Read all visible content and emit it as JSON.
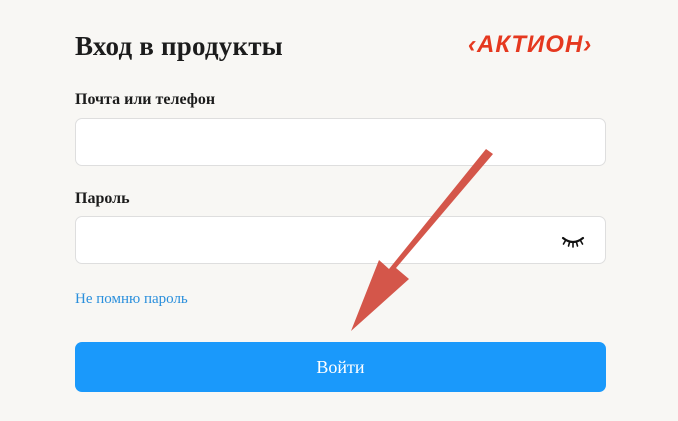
{
  "header": {
    "title": "Вход в продукты",
    "logo_text": "‹АКТИОН›",
    "logo_color": "#e5381f"
  },
  "form": {
    "email_label": "Почта или телефон",
    "email_value": "",
    "password_label": "Пароль",
    "password_value": "",
    "password_toggle_icon": "closed-eye-icon",
    "forgot_password_link": "Не помню пароль",
    "submit_label": "Войти",
    "submit_color": "#1a99fb",
    "link_color": "#2a8fdc"
  },
  "annotation": {
    "arrow_icon": "red-arrow-pointing-to-submit",
    "arrow_color": "#d4564a"
  }
}
